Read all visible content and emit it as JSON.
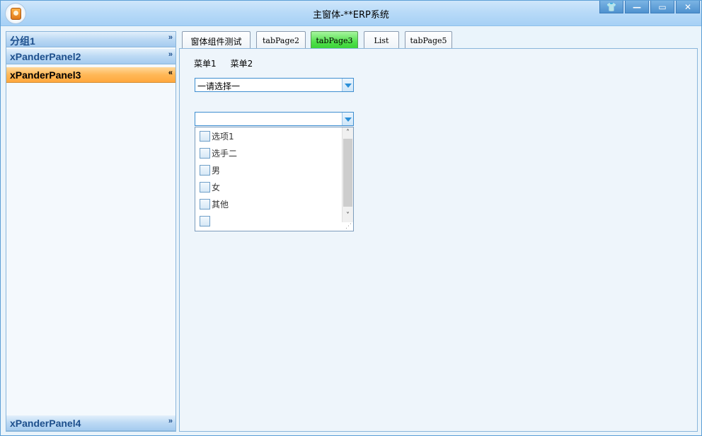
{
  "window": {
    "title": "主窗体-**ERP系统",
    "controls": [
      "skin-icon",
      "minimize-icon",
      "maximize-icon",
      "close-icon"
    ]
  },
  "sidebar": {
    "panels": [
      {
        "label": "分组1",
        "expanded": false
      },
      {
        "label": "xPanderPanel2",
        "expanded": false
      },
      {
        "label": "xPanderPanel3",
        "expanded": true
      },
      {
        "label": "xPanderPanel4",
        "expanded": false
      }
    ]
  },
  "tabs": [
    {
      "label": "窗体组件测试",
      "selected": false
    },
    {
      "label": "tabPage2",
      "selected": false
    },
    {
      "label": "tabPage3",
      "selected": true
    },
    {
      "label": "List",
      "selected": false
    },
    {
      "label": "tabPage5",
      "selected": false
    }
  ],
  "page": {
    "menu": [
      "菜单1",
      "菜单2"
    ],
    "combo1": {
      "value": "一请选择一"
    },
    "combo2": {
      "value": ""
    },
    "checklist": [
      "选项1",
      "选手二",
      "男",
      "女",
      "其他",
      ""
    ]
  },
  "colors": {
    "accent": "#3e8ed0",
    "active_panel": "#ffb857",
    "selected_tab": "#4fe04a"
  }
}
